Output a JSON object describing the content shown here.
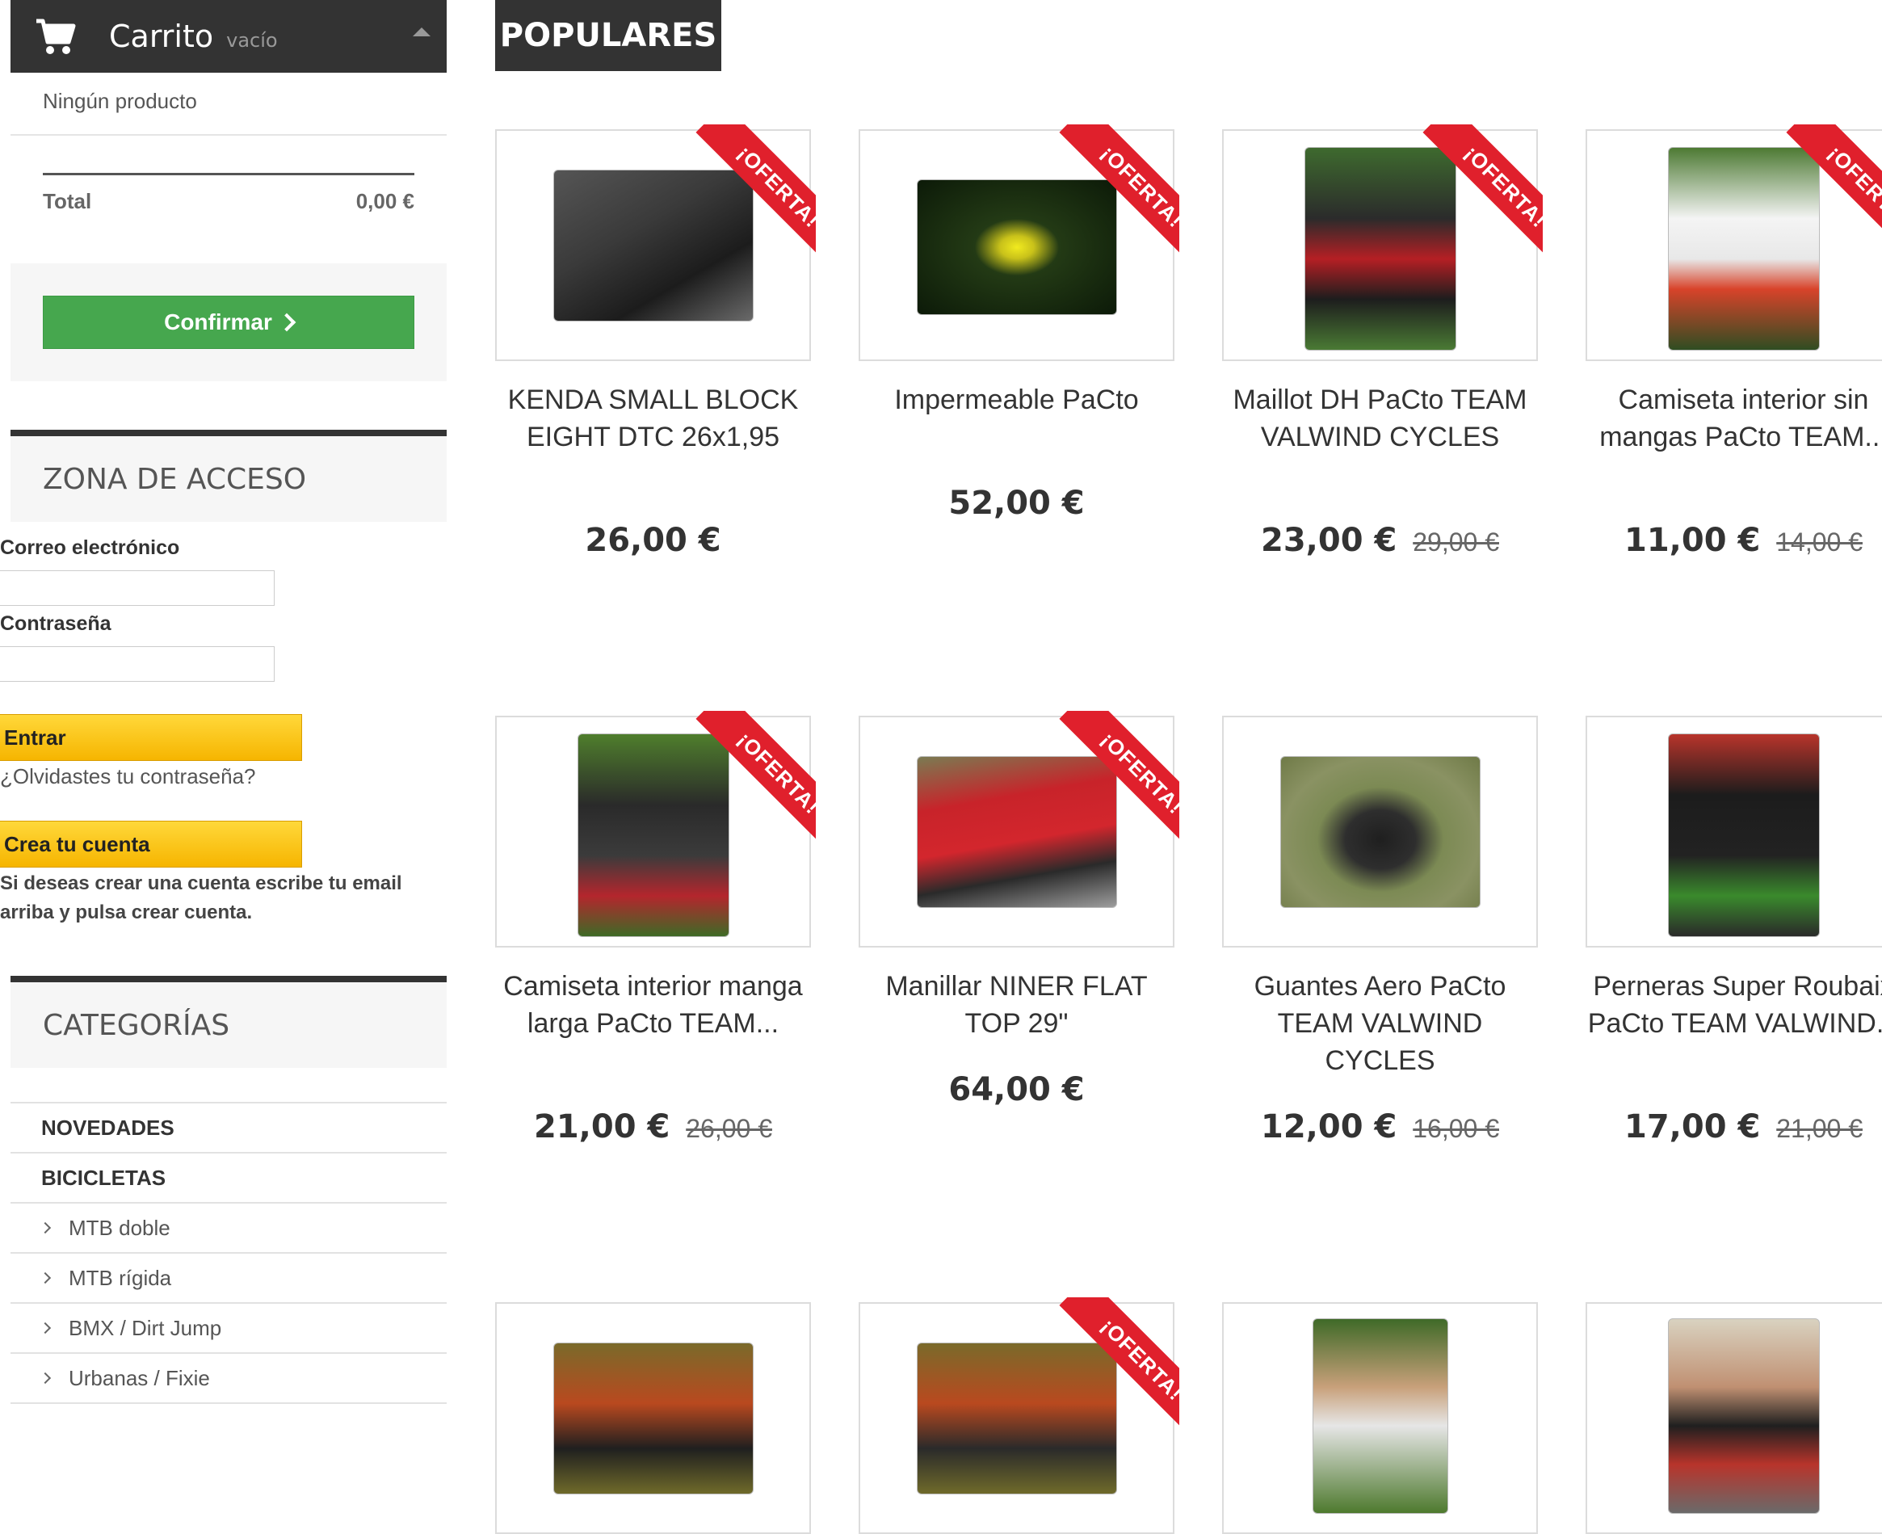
{
  "cart": {
    "title": "Carrito",
    "status": "vacío",
    "empty_text": "Ningún producto",
    "total_label": "Total",
    "total_value": "0,00 €",
    "confirm_label": "Confirmar"
  },
  "login": {
    "heading": "ZONA DE ACCESO",
    "email_label": "Correo electrónico",
    "password_label": "Contraseña",
    "submit_label": "Entrar",
    "forgot_link": "¿Olvidastes tu contraseña?",
    "create_label": "Crea tu cuenta",
    "create_note": "Si deseas crear una cuenta escribe tu email arriba y pulsa crear cuenta."
  },
  "categories": {
    "heading": "CATEGORÍAS",
    "items": [
      {
        "label": "NOVEDADES"
      },
      {
        "label": "BICICLETAS"
      },
      {
        "label": "MTB doble"
      },
      {
        "label": "MTB rígida"
      },
      {
        "label": "BMX / Dirt Jump"
      },
      {
        "label": "Urbanas / Fixie"
      }
    ]
  },
  "populares": {
    "heading": "POPULARES",
    "badge": "¡OFERTA!",
    "products": [
      {
        "name": "KENDA SMALL BLOCK EIGHT DTC 26x1,95",
        "price": "26,00 €",
        "old_price": "",
        "offer": true
      },
      {
        "name": "Impermeable PaCto",
        "price": "52,00 €",
        "old_price": "",
        "offer": true
      },
      {
        "name": "Maillot DH PaCto TEAM VALWIND CYCLES",
        "price": "23,00 €",
        "old_price": "29,00 €",
        "offer": true
      },
      {
        "name": "Camiseta interior sin mangas PaCto TEAM...",
        "price": "11,00 €",
        "old_price": "14,00 €",
        "offer": true
      },
      {
        "name": "Camiseta interior manga larga PaCto TEAM...",
        "price": "21,00 €",
        "old_price": "26,00 €",
        "offer": true
      },
      {
        "name": "Manillar NINER FLAT TOP 29\"",
        "price": "64,00 €",
        "old_price": "",
        "offer": true
      },
      {
        "name": "Guantes Aero PaCto TEAM VALWIND CYCLES",
        "price": "12,00 €",
        "old_price": "16,00 €",
        "offer": false
      },
      {
        "name": "Perneras Super Roubaix PaCto TEAM VALWIND...",
        "price": "17,00 €",
        "old_price": "21,00 €",
        "offer": false
      }
    ]
  },
  "colors": {
    "dark": "#333333",
    "confirm_green": "#46a74e",
    "button_yellow": "#f6b500",
    "offer_red": "#e0202c"
  }
}
